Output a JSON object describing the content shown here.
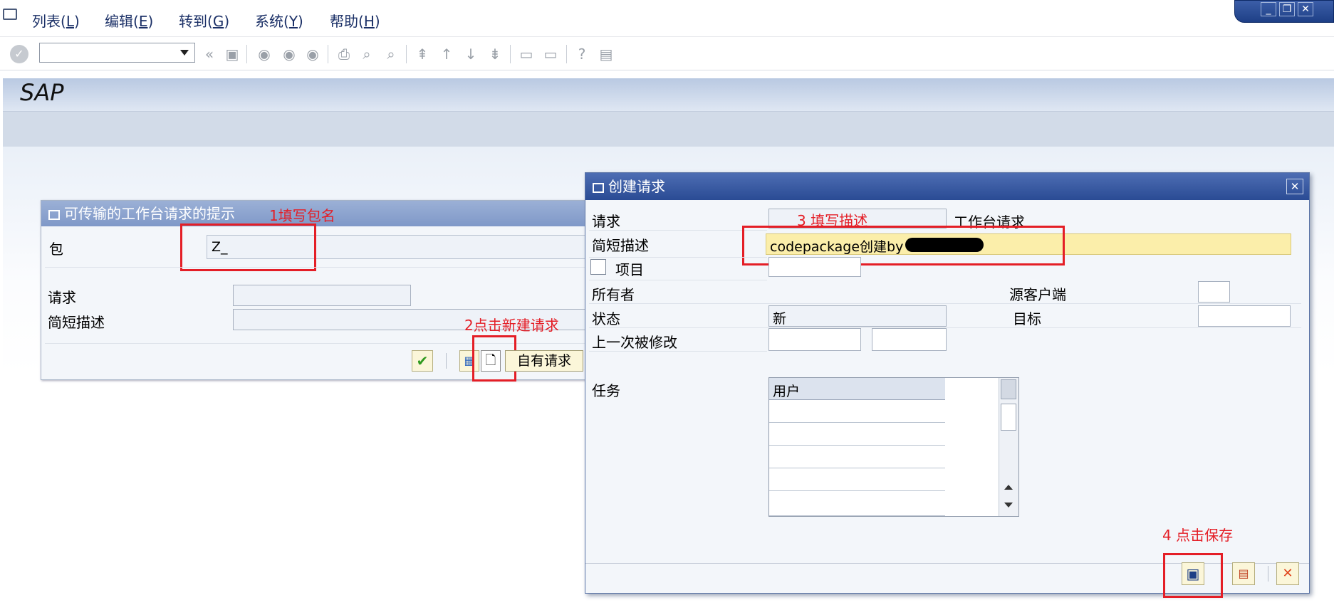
{
  "menu": {
    "items": [
      {
        "label": "列表(",
        "key": "L",
        "end": ")"
      },
      {
        "label": "编辑(",
        "key": "E",
        "end": ")"
      },
      {
        "label": "转到(",
        "key": "G",
        "end": ")"
      },
      {
        "label": "系统(",
        "key": "Y",
        "end": ")"
      },
      {
        "label": "帮助(",
        "key": "H",
        "end": ")"
      }
    ]
  },
  "window_controls": {
    "minimize": "_",
    "restore": "❐",
    "close": "✕"
  },
  "app": {
    "title": "SAP"
  },
  "dialog1": {
    "title": "可传输的工作台请求的提示",
    "annotation_1": "1填写包名",
    "package_label": "包",
    "package_value": "Z_",
    "request_label": "请求",
    "short_desc_label": "简短描述",
    "annotation_2": "2点击新建请求",
    "own_requests_label": "自有请求"
  },
  "dialog2": {
    "title": "创建请求",
    "request_label": "请求",
    "annotation_3": "3 填写描述",
    "request_type": "工作台请求",
    "short_desc_label": "简短描述",
    "short_desc_value": "codepackage创建by",
    "project_label": "项目",
    "owner_label": "所有者",
    "source_client_label": "源客户端",
    "status_label": "状态",
    "status_value": "新",
    "target_label": "目标",
    "last_changed_label": "上一次被修改",
    "tasks_label": "任务",
    "tasks_column": "用户",
    "annotation_4": "4 点击保存"
  },
  "colors": {
    "annotation": "#e41e26",
    "dialog_header": "#2a4b94",
    "highlight_field": "#fbeeaa"
  }
}
